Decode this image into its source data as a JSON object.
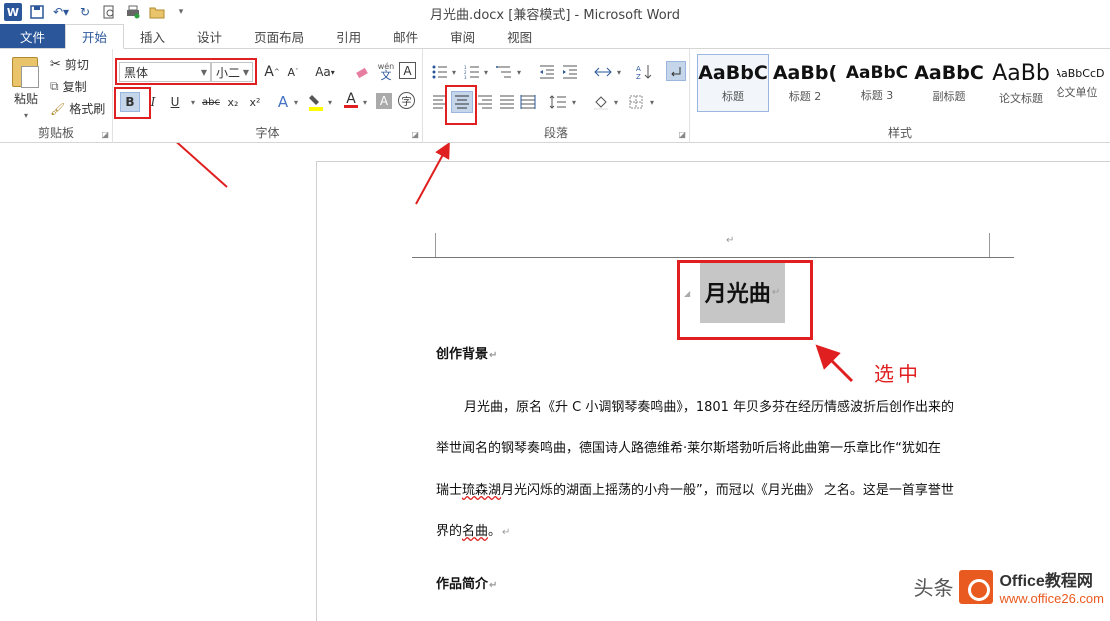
{
  "window": {
    "title": "月光曲.docx [兼容模式] - Microsoft Word",
    "qat_icons": [
      "word-icon",
      "save-icon",
      "undo-icon",
      "redo-icon",
      "print-preview-icon",
      "quick-print-icon",
      "open-folder-icon",
      "customize-icon"
    ]
  },
  "tabs": [
    "文件",
    "开始",
    "插入",
    "设计",
    "页面布局",
    "引用",
    "邮件",
    "审阅",
    "视图"
  ],
  "active_tab": "开始",
  "clipboard": {
    "paste": "粘贴",
    "cut": "剪切",
    "copy": "复制",
    "format_painter": "格式刷",
    "label": "剪贴板"
  },
  "font": {
    "family": "黑体",
    "size": "小二",
    "label": "字体",
    "bold": "B",
    "italic": "I",
    "underline": "U",
    "strikethrough": "abc",
    "subscript": "x₂",
    "superscript": "x²",
    "aa": "Aa",
    "grow": "A",
    "shrink": "A",
    "phonetic": "wén",
    "phonetic_sub": "文",
    "border_char": "A",
    "text_effect": "A",
    "font_color": "A",
    "shading": "A",
    "enclose": "字"
  },
  "paragraph": {
    "label": "段落",
    "active_alignment": "center"
  },
  "styles": {
    "label": "样式",
    "items": [
      {
        "sample": "AaBbC",
        "name": "标题"
      },
      {
        "sample": "AaBb(",
        "name": "标题 2"
      },
      {
        "sample": "AaBbC",
        "name": "标题 3"
      },
      {
        "sample": "AaBbC",
        "name": "副标题"
      },
      {
        "sample": "AaBb",
        "name": "论文标题"
      },
      {
        "sample": "AaBbCcD",
        "name": "论文单位"
      }
    ]
  },
  "document": {
    "title": "月光曲",
    "heading1": "创作背景",
    "para1_line1": "月光曲，原名《升 C 小调钢琴奏鸣曲》，1801 年贝多芬在经历情感波折后创作出来的",
    "para1_line2": "举世闻名的钢琴奏鸣曲，德国诗人路德维希·莱尔斯塔勃听后将此曲第一乐章比作“犹如在",
    "para1_line3a": "瑞士",
    "para1_line3b": "琉森湖",
    "para1_line3c": "月光闪烁的湖面上摇荡的小舟一般”，而冠以《月光曲》",
    "para1_line3d": "之名。这是一首享誉世",
    "para1_line4a": "界的",
    "para1_line4b": "名曲",
    "para1_line4c": "。",
    "heading2": "作品简介",
    "para_mark": "↵"
  },
  "annotation": {
    "text": "选中"
  },
  "watermark": {
    "tou": "头条",
    "brand": "Office教程网",
    "url": "www.office26.com"
  }
}
